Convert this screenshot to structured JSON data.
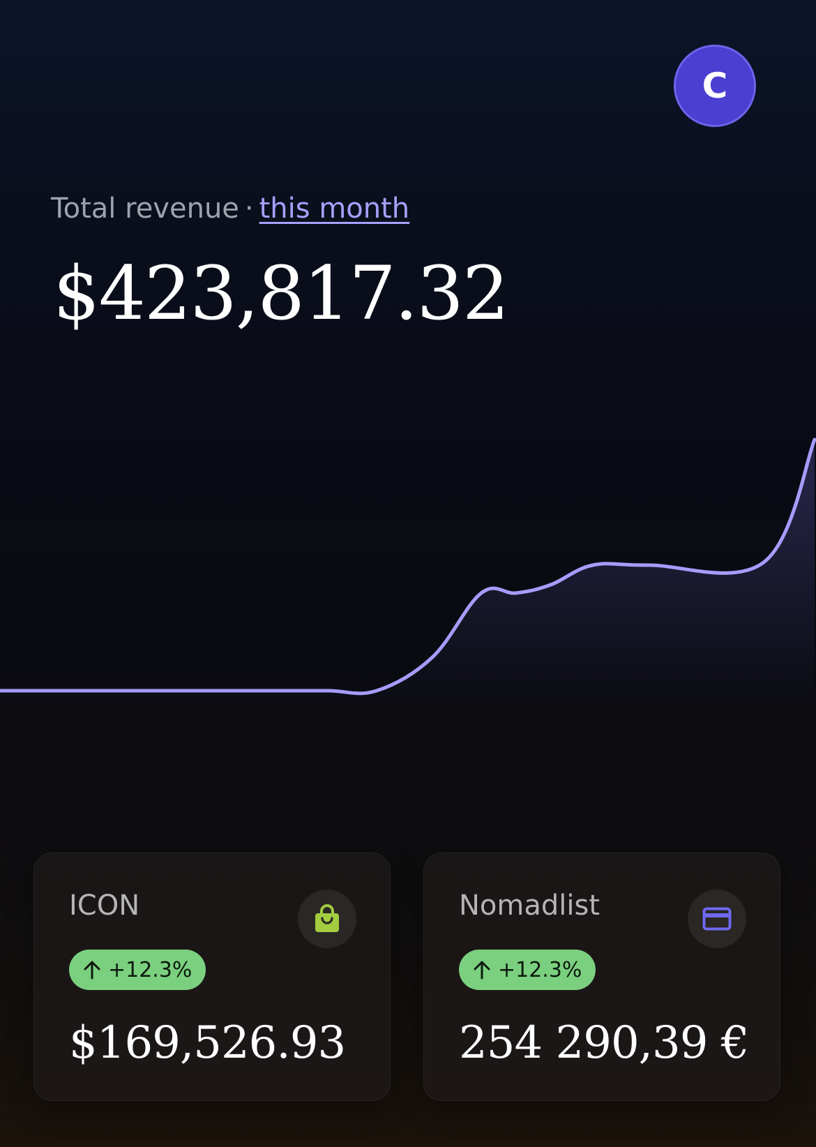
{
  "avatar": {
    "initial": "C",
    "color": "#4a3fd0"
  },
  "revenue": {
    "label": "Total revenue",
    "separator": "·",
    "period_link": "this month",
    "value": "$423,817.32"
  },
  "chart_data": {
    "type": "area",
    "x": [
      0,
      1,
      2,
      3,
      4,
      5,
      6,
      7,
      8,
      9,
      10,
      11
    ],
    "values": [
      10,
      10,
      10,
      10,
      22,
      45,
      45,
      48,
      55,
      55,
      56,
      100
    ],
    "line_color": "#a79cff"
  },
  "accounts": [
    {
      "name": "ICON",
      "icon": "shopping-bag-icon",
      "icon_color": "#a3cc3f",
      "change": "+12.3%",
      "value": "$169,526.93"
    },
    {
      "name": "Nomadlist",
      "icon": "credit-card-icon",
      "icon_color": "#6f68f0",
      "change": "+12.3%",
      "value": "254 290,39 €"
    }
  ],
  "colors": {
    "accent": "#a9a0ff",
    "badge_bg": "#7bd07f"
  }
}
